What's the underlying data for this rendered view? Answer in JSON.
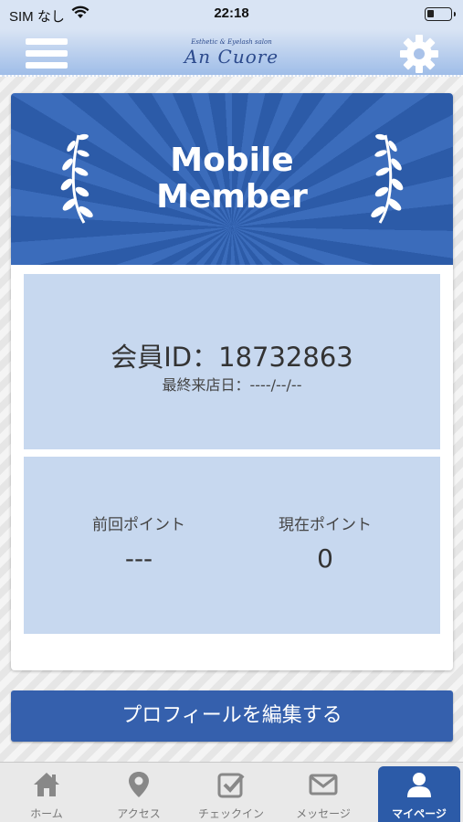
{
  "status_bar": {
    "carrier": "SIM なし",
    "time": "22:18"
  },
  "header": {
    "logo_subtitle": "Esthetic & Eyelash salon",
    "logo_title": "An Cuore"
  },
  "banner": {
    "title_line1": "Mobile",
    "title_line2": "Member"
  },
  "member": {
    "id_line": "会員ID：18732863",
    "last_visit_line": "最終来店日：----/--/--"
  },
  "points": {
    "previous_label": "前回ポイント",
    "previous_value": "---",
    "current_label": "現在ポイント",
    "current_value": "0"
  },
  "edit_profile_label": "プロフィールを編集する",
  "tabs": [
    {
      "label": "ホーム",
      "icon": "home-icon",
      "active": false
    },
    {
      "label": "アクセス",
      "icon": "map-pin-icon",
      "active": false
    },
    {
      "label": "チェックイン",
      "icon": "checkin-icon",
      "active": false
    },
    {
      "label": "メッセージ",
      "icon": "mail-icon",
      "active": false
    },
    {
      "label": "マイページ",
      "icon": "user-icon",
      "active": true
    }
  ],
  "colors": {
    "brand_blue": "#2c5ba8",
    "panel_blue": "#c7d8ef",
    "button_blue": "#3560ad"
  }
}
